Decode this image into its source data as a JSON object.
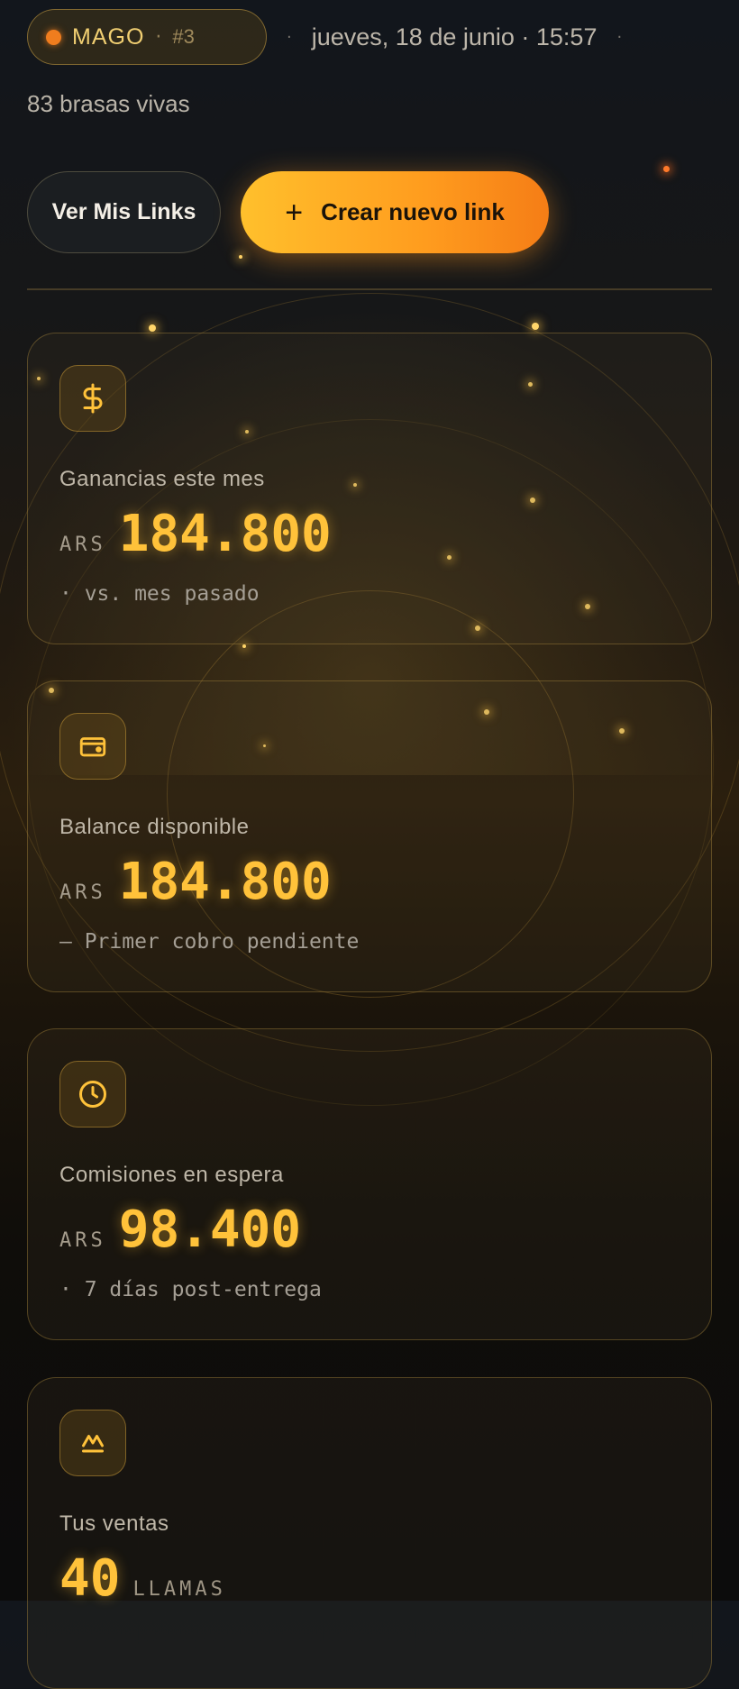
{
  "header": {
    "user_name": "MAGO",
    "rank": "#3",
    "datetime": "jueves, 18 de junio · 15:57",
    "embers": "83 brasas vivas"
  },
  "actions": {
    "view_links_label": "Ver Mis Links",
    "create_link_label": "Crear nuevo link"
  },
  "cards": [
    {
      "icon": "dollar-icon",
      "label": "Ganancias este mes",
      "currency": "ARS",
      "amount": "184.800",
      "note": "· vs. mes pasado"
    },
    {
      "icon": "wallet-icon",
      "label": "Balance disponible",
      "currency": "ARS",
      "amount": "184.800",
      "note": "— Primer cobro pendiente"
    },
    {
      "icon": "clock-icon",
      "label": "Comisiones en espera",
      "currency": "ARS",
      "amount": "98.400",
      "note": "· 7 días post-entrega"
    },
    {
      "icon": "flame-icon",
      "label": "Tus ventas",
      "amount": "40",
      "unit": "LLAMAS"
    }
  ],
  "colors": {
    "accent": "#ffc23a",
    "primary_gradient_start": "#ffc02c",
    "primary_gradient_end": "#f57d16",
    "live_dot": "#f07d1e"
  }
}
